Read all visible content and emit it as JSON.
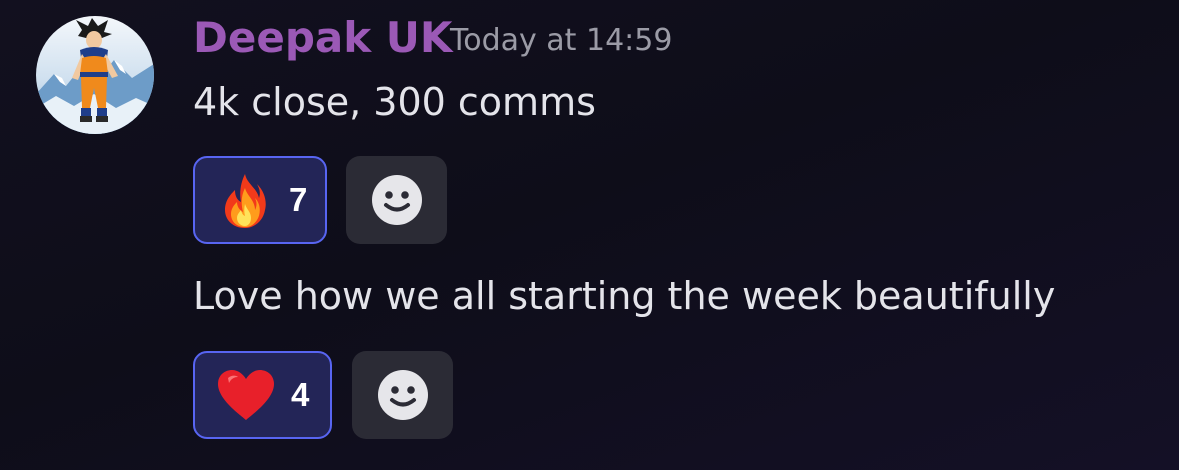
{
  "message": {
    "author": "Deepak UK",
    "timestamp": "Today at 14:59",
    "author_color": "#9b59b6",
    "avatar_icon": "goku-avatar"
  },
  "messages": [
    {
      "text": "4k close, 300 comms",
      "reaction": {
        "emoji": "fire-emoji",
        "count": "7"
      },
      "add_reaction_icon": "smiley-add-reaction-icon"
    },
    {
      "text": "Love how we all starting the week beautifully",
      "reaction": {
        "emoji": "red-heart-emoji",
        "count": "4"
      },
      "add_reaction_icon": "smiley-add-reaction-icon"
    }
  ],
  "colors": {
    "background": "#0f0e1a",
    "reaction_bg": "#232557",
    "reaction_border": "#5865f2",
    "add_reaction_bg": "#2b2b35",
    "text": "#e4e4ea",
    "timestamp": "#9b9ba6"
  }
}
